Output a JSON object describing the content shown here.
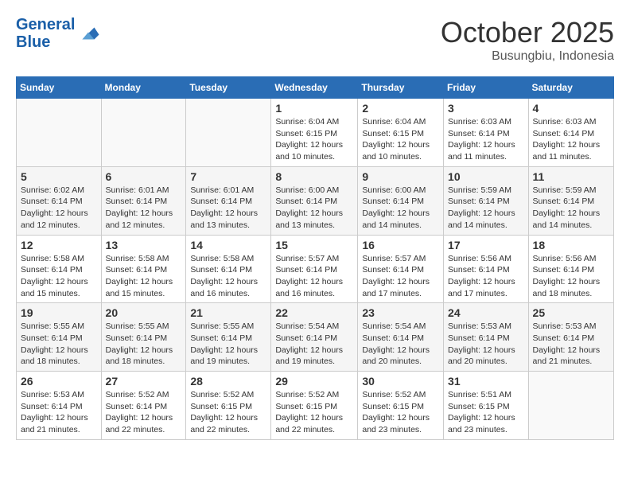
{
  "header": {
    "logo_line1": "General",
    "logo_line2": "Blue",
    "month": "October 2025",
    "location": "Busungbiu, Indonesia"
  },
  "weekdays": [
    "Sunday",
    "Monday",
    "Tuesday",
    "Wednesday",
    "Thursday",
    "Friday",
    "Saturday"
  ],
  "weeks": [
    [
      {
        "day": "",
        "info": ""
      },
      {
        "day": "",
        "info": ""
      },
      {
        "day": "",
        "info": ""
      },
      {
        "day": "1",
        "info": "Sunrise: 6:04 AM\nSunset: 6:15 PM\nDaylight: 12 hours\nand 10 minutes."
      },
      {
        "day": "2",
        "info": "Sunrise: 6:04 AM\nSunset: 6:15 PM\nDaylight: 12 hours\nand 10 minutes."
      },
      {
        "day": "3",
        "info": "Sunrise: 6:03 AM\nSunset: 6:14 PM\nDaylight: 12 hours\nand 11 minutes."
      },
      {
        "day": "4",
        "info": "Sunrise: 6:03 AM\nSunset: 6:14 PM\nDaylight: 12 hours\nand 11 minutes."
      }
    ],
    [
      {
        "day": "5",
        "info": "Sunrise: 6:02 AM\nSunset: 6:14 PM\nDaylight: 12 hours\nand 12 minutes."
      },
      {
        "day": "6",
        "info": "Sunrise: 6:01 AM\nSunset: 6:14 PM\nDaylight: 12 hours\nand 12 minutes."
      },
      {
        "day": "7",
        "info": "Sunrise: 6:01 AM\nSunset: 6:14 PM\nDaylight: 12 hours\nand 13 minutes."
      },
      {
        "day": "8",
        "info": "Sunrise: 6:00 AM\nSunset: 6:14 PM\nDaylight: 12 hours\nand 13 minutes."
      },
      {
        "day": "9",
        "info": "Sunrise: 6:00 AM\nSunset: 6:14 PM\nDaylight: 12 hours\nand 14 minutes."
      },
      {
        "day": "10",
        "info": "Sunrise: 5:59 AM\nSunset: 6:14 PM\nDaylight: 12 hours\nand 14 minutes."
      },
      {
        "day": "11",
        "info": "Sunrise: 5:59 AM\nSunset: 6:14 PM\nDaylight: 12 hours\nand 14 minutes."
      }
    ],
    [
      {
        "day": "12",
        "info": "Sunrise: 5:58 AM\nSunset: 6:14 PM\nDaylight: 12 hours\nand 15 minutes."
      },
      {
        "day": "13",
        "info": "Sunrise: 5:58 AM\nSunset: 6:14 PM\nDaylight: 12 hours\nand 15 minutes."
      },
      {
        "day": "14",
        "info": "Sunrise: 5:58 AM\nSunset: 6:14 PM\nDaylight: 12 hours\nand 16 minutes."
      },
      {
        "day": "15",
        "info": "Sunrise: 5:57 AM\nSunset: 6:14 PM\nDaylight: 12 hours\nand 16 minutes."
      },
      {
        "day": "16",
        "info": "Sunrise: 5:57 AM\nSunset: 6:14 PM\nDaylight: 12 hours\nand 17 minutes."
      },
      {
        "day": "17",
        "info": "Sunrise: 5:56 AM\nSunset: 6:14 PM\nDaylight: 12 hours\nand 17 minutes."
      },
      {
        "day": "18",
        "info": "Sunrise: 5:56 AM\nSunset: 6:14 PM\nDaylight: 12 hours\nand 18 minutes."
      }
    ],
    [
      {
        "day": "19",
        "info": "Sunrise: 5:55 AM\nSunset: 6:14 PM\nDaylight: 12 hours\nand 18 minutes."
      },
      {
        "day": "20",
        "info": "Sunrise: 5:55 AM\nSunset: 6:14 PM\nDaylight: 12 hours\nand 18 minutes."
      },
      {
        "day": "21",
        "info": "Sunrise: 5:55 AM\nSunset: 6:14 PM\nDaylight: 12 hours\nand 19 minutes."
      },
      {
        "day": "22",
        "info": "Sunrise: 5:54 AM\nSunset: 6:14 PM\nDaylight: 12 hours\nand 19 minutes."
      },
      {
        "day": "23",
        "info": "Sunrise: 5:54 AM\nSunset: 6:14 PM\nDaylight: 12 hours\nand 20 minutes."
      },
      {
        "day": "24",
        "info": "Sunrise: 5:53 AM\nSunset: 6:14 PM\nDaylight: 12 hours\nand 20 minutes."
      },
      {
        "day": "25",
        "info": "Sunrise: 5:53 AM\nSunset: 6:14 PM\nDaylight: 12 hours\nand 21 minutes."
      }
    ],
    [
      {
        "day": "26",
        "info": "Sunrise: 5:53 AM\nSunset: 6:14 PM\nDaylight: 12 hours\nand 21 minutes."
      },
      {
        "day": "27",
        "info": "Sunrise: 5:52 AM\nSunset: 6:14 PM\nDaylight: 12 hours\nand 22 minutes."
      },
      {
        "day": "28",
        "info": "Sunrise: 5:52 AM\nSunset: 6:15 PM\nDaylight: 12 hours\nand 22 minutes."
      },
      {
        "day": "29",
        "info": "Sunrise: 5:52 AM\nSunset: 6:15 PM\nDaylight: 12 hours\nand 22 minutes."
      },
      {
        "day": "30",
        "info": "Sunrise: 5:52 AM\nSunset: 6:15 PM\nDaylight: 12 hours\nand 23 minutes."
      },
      {
        "day": "31",
        "info": "Sunrise: 5:51 AM\nSunset: 6:15 PM\nDaylight: 12 hours\nand 23 minutes."
      },
      {
        "day": "",
        "info": ""
      }
    ]
  ]
}
